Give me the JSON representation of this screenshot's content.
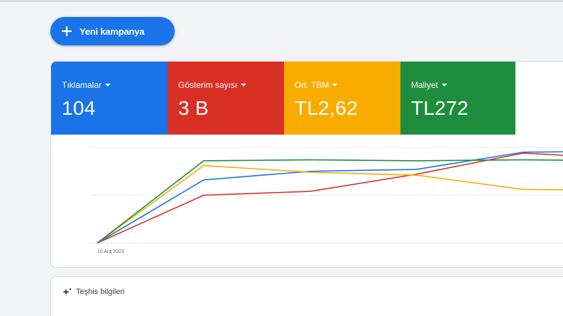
{
  "toolbar": {
    "new_campaign_label": "Yeni kampanya",
    "new_campaign_icon": "plus-icon"
  },
  "metrics": [
    {
      "label": "Tıklamalar",
      "value": "104",
      "color": "#1a73e8"
    },
    {
      "label": "Gösterim sayısı",
      "value": "3 B",
      "color": "#d93025"
    },
    {
      "label": "Ort. TBM",
      "value": "TL2,62",
      "color": "#f9ab00"
    },
    {
      "label": "Maliyet",
      "value": "TL272",
      "color": "#1e8e3e"
    }
  ],
  "chart_data": {
    "type": "line",
    "x_start_label": "10 Ara 2023",
    "grid": true,
    "y_scale": "normalized per metric",
    "x": [
      0,
      1,
      2,
      3,
      4,
      5
    ],
    "series": [
      {
        "name": "Tıklamalar",
        "color": "#1a73e8",
        "values": [
          0,
          0.66,
          0.75,
          0.77,
          0.95,
          0.96
        ]
      },
      {
        "name": "Gösterim sayısı",
        "color": "#d93025",
        "values": [
          0,
          0.5,
          0.54,
          0.72,
          0.94,
          0.88
        ]
      },
      {
        "name": "Ort. TBM",
        "color": "#f9ab00",
        "values": [
          0,
          0.81,
          0.74,
          0.71,
          0.56,
          0.55
        ]
      },
      {
        "name": "Maliyet",
        "color": "#1e8e3e",
        "values": [
          0,
          0.86,
          0.87,
          0.86,
          0.87,
          0.86
        ]
      }
    ]
  },
  "diagnostics": {
    "title": "Teşhis bilgileri",
    "icon": "sparkle-icon"
  }
}
